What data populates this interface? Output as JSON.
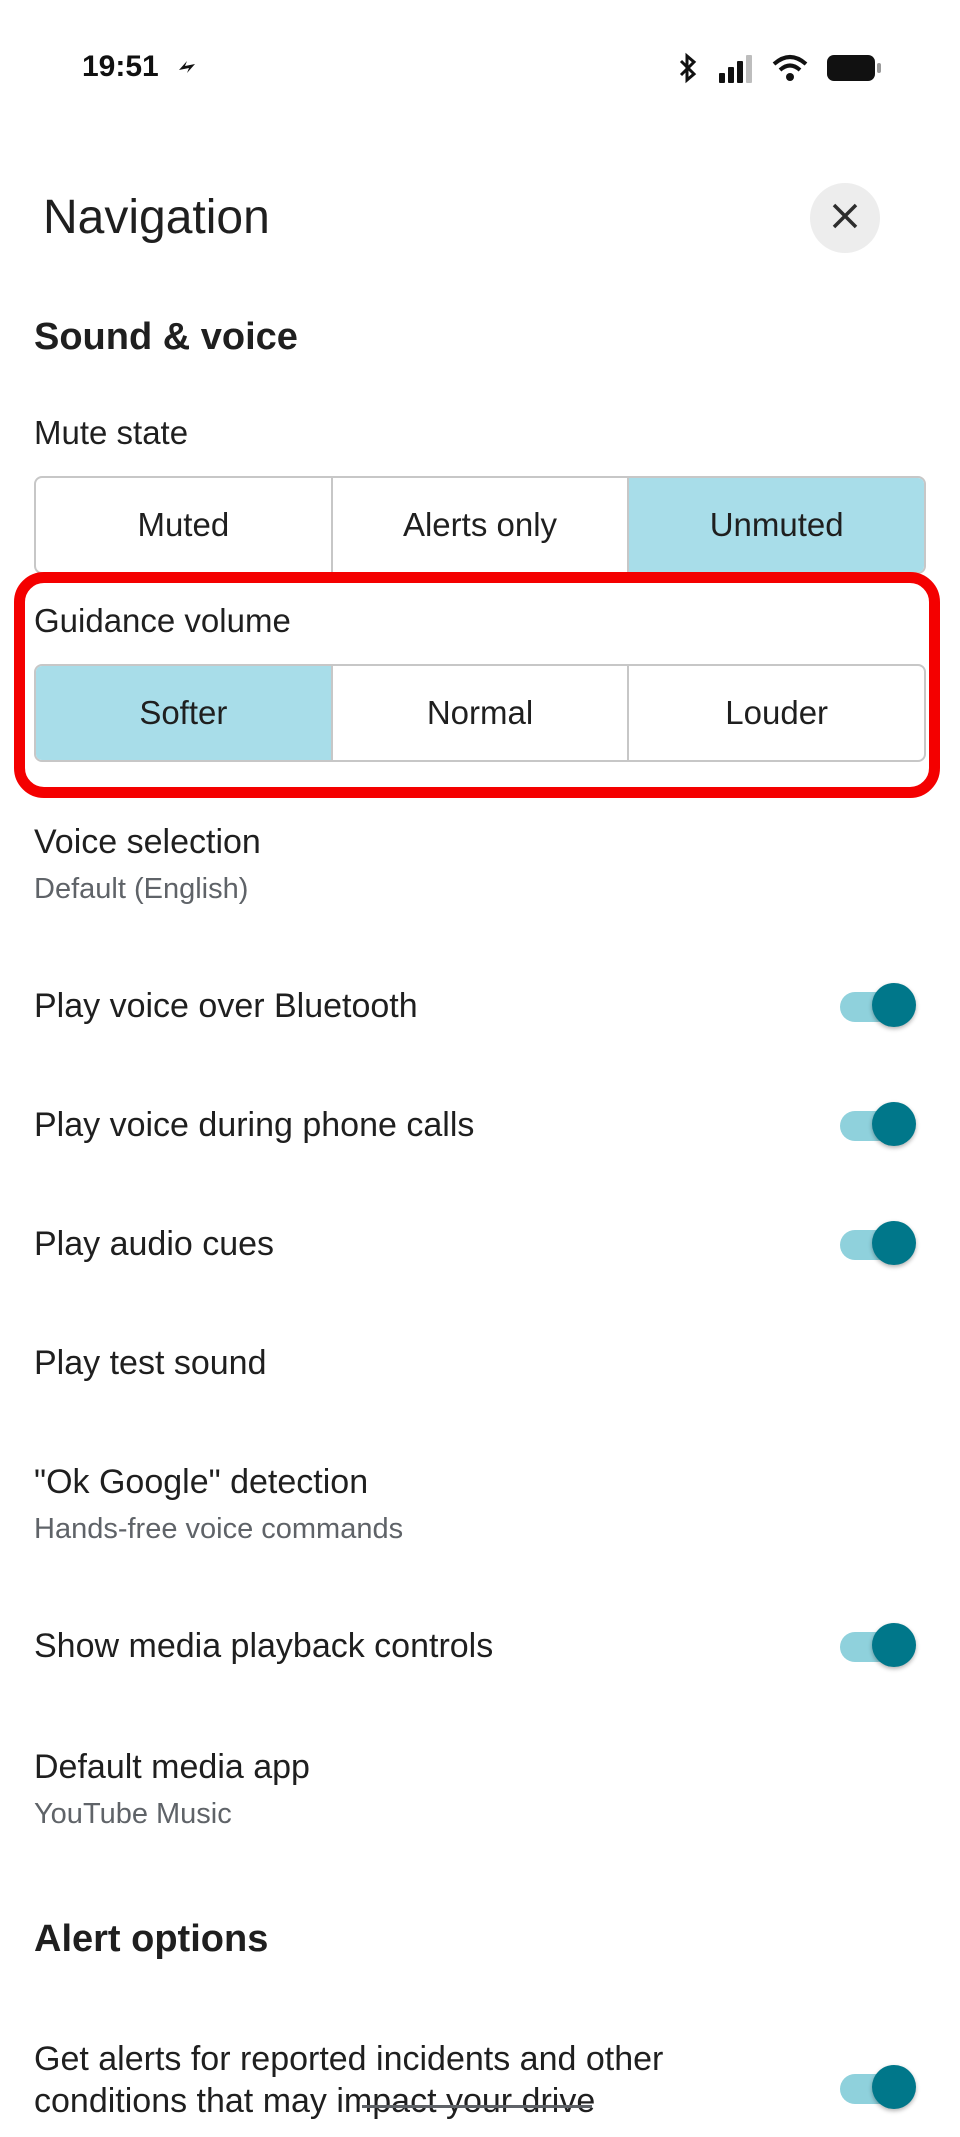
{
  "status_bar": {
    "time": "19:51"
  },
  "header": {
    "title": "Navigation",
    "close_icon": "close-icon"
  },
  "sound_voice": {
    "section_title": "Sound & voice",
    "mute_state": {
      "label": "Mute state",
      "options": [
        "Muted",
        "Alerts only",
        "Unmuted"
      ],
      "selected": "Unmuted"
    },
    "guidance_volume": {
      "label": "Guidance volume",
      "options": [
        "Softer",
        "Normal",
        "Louder"
      ],
      "selected": "Softer"
    },
    "voice_selection": {
      "title": "Voice selection",
      "subtitle": "Default (English)"
    },
    "bluetooth": {
      "title": "Play voice over Bluetooth",
      "on": true
    },
    "phone_calls": {
      "title": "Play voice during phone calls",
      "on": true
    },
    "audio_cues": {
      "title": "Play audio cues",
      "on": true
    },
    "test_sound": {
      "title": "Play test sound"
    },
    "ok_google": {
      "title": "\"Ok Google\" detection",
      "subtitle": "Hands-free voice commands"
    },
    "media_controls": {
      "title": "Show media playback controls",
      "on": true
    },
    "default_media": {
      "title": "Default media app",
      "subtitle": "YouTube Music"
    }
  },
  "alert_options": {
    "section_title": "Alert options",
    "incidents": {
      "title": "Get alerts for reported incidents and other conditions that may impact your drive",
      "on": true
    }
  },
  "colors": {
    "selected_segment": "#a8dde9",
    "toggle_thumb": "#00778a",
    "toggle_track": "#8fd1dc",
    "highlight_border": "#f40000"
  }
}
